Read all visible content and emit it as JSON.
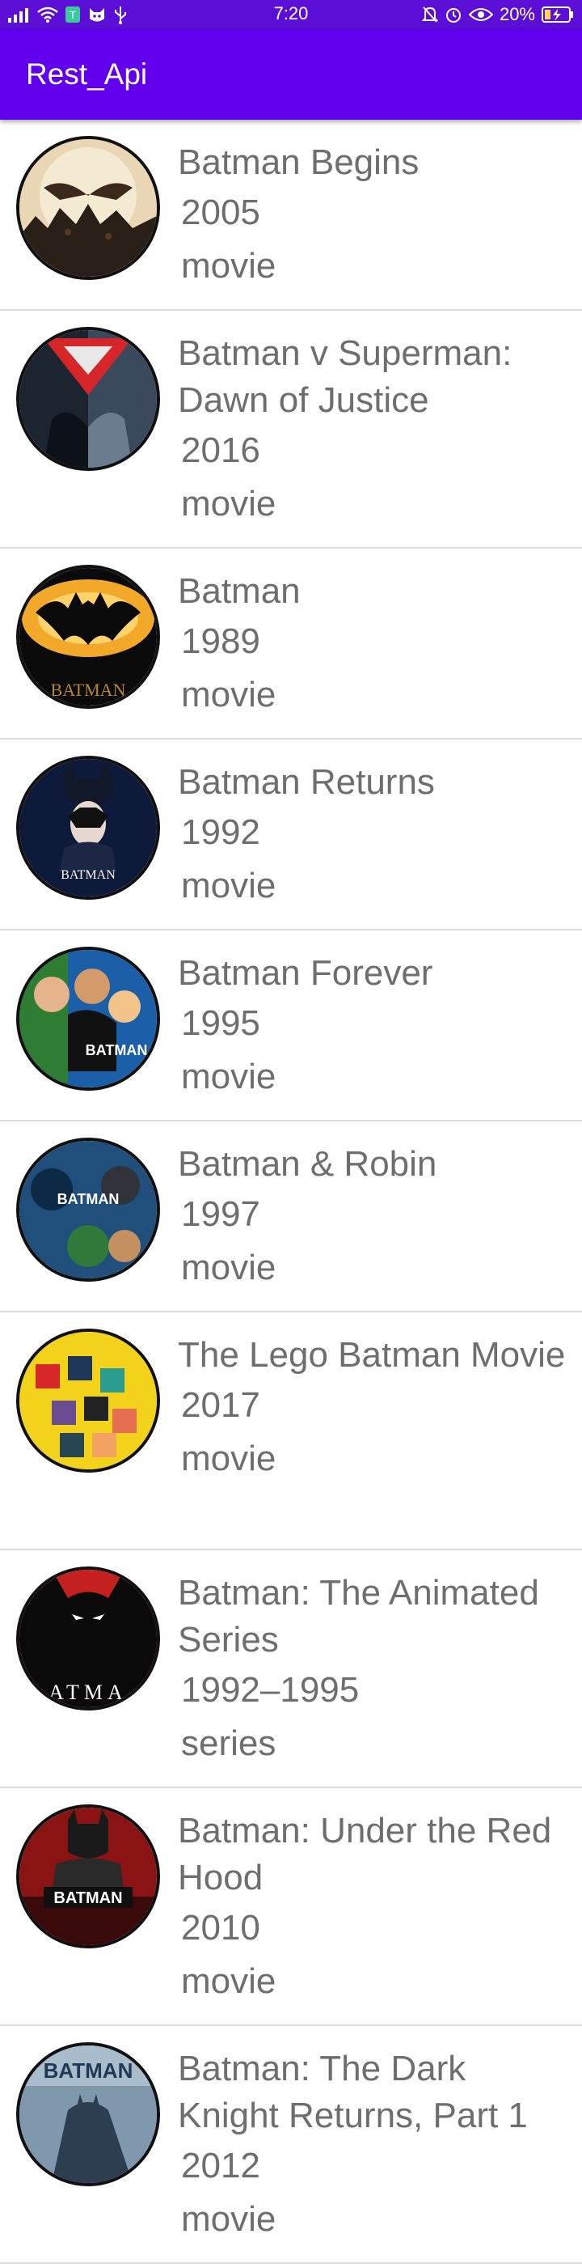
{
  "status_bar": {
    "time": "7:20",
    "battery": "20%",
    "background": "#5b0fd6"
  },
  "app_bar": {
    "title": "Rest_Api",
    "background": "#6200ee"
  },
  "items": [
    {
      "title": "Batman Begins",
      "year": "2005",
      "type": "movie",
      "poster_icon": "batman-begins-poster"
    },
    {
      "title": "Batman v Superman: Dawn of Justice",
      "year": "2016",
      "type": "movie",
      "poster_icon": "batman-v-superman-poster"
    },
    {
      "title": "Batman",
      "year": "1989",
      "type": "movie",
      "poster_icon": "batman-1989-poster",
      "poster_text": "BATMAN"
    },
    {
      "title": "Batman Returns",
      "year": "1992",
      "type": "movie",
      "poster_icon": "batman-returns-poster",
      "poster_text": "BATMAN"
    },
    {
      "title": "Batman Forever",
      "year": "1995",
      "type": "movie",
      "poster_icon": "batman-forever-poster",
      "poster_text": "BATMAN"
    },
    {
      "title": "Batman & Robin",
      "year": "1997",
      "type": "movie",
      "poster_icon": "batman-and-robin-poster",
      "poster_text": "BATMAN"
    },
    {
      "title": "The Lego Batman Movie",
      "year": "2017",
      "type": "movie",
      "poster_icon": "lego-batman-poster"
    },
    {
      "title": "Batman: The Animated Series",
      "year": "1992–1995",
      "type": "series",
      "poster_icon": "animated-series-poster",
      "poster_text": "ATMA"
    },
    {
      "title": "Batman: Under the Red Hood",
      "year": "2010",
      "type": "movie",
      "poster_icon": "under-the-red-hood-poster",
      "poster_text": "BATMAN"
    },
    {
      "title": "Batman: The Dark Knight Returns, Part 1",
      "year": "2012",
      "type": "movie",
      "poster_icon": "dark-knight-returns-poster",
      "poster_text": "BATMAN"
    }
  ]
}
